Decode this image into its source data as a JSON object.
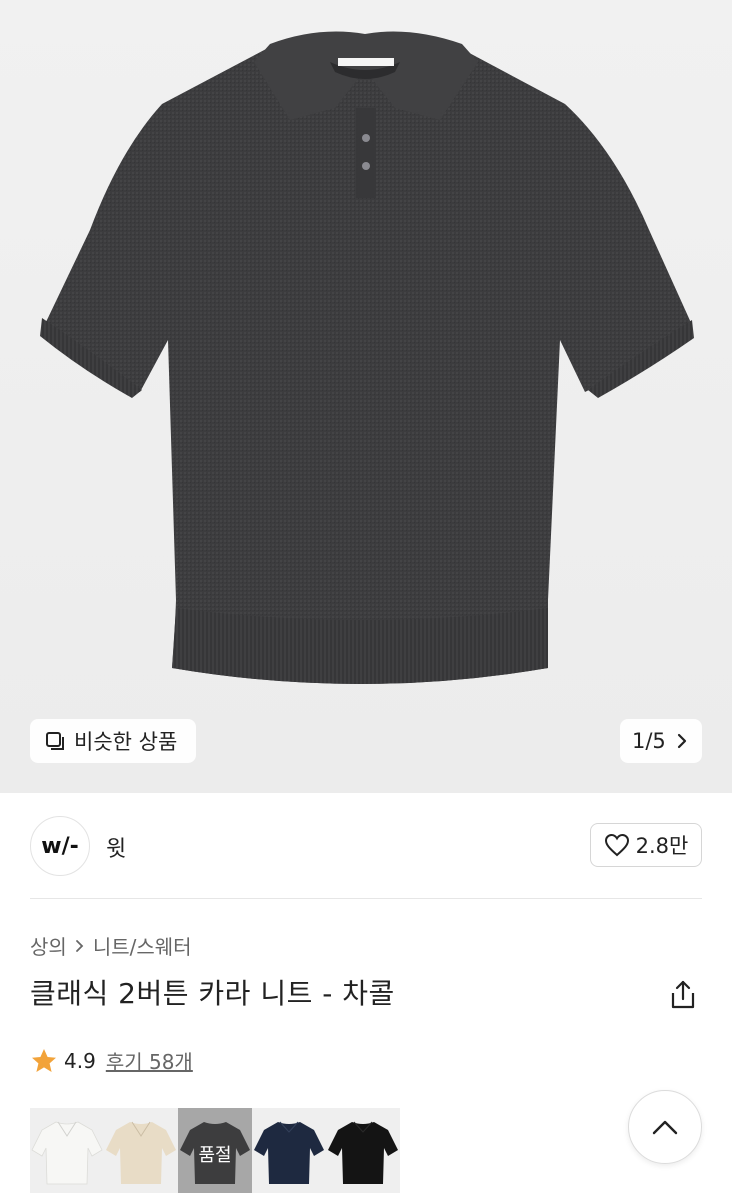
{
  "gallery": {
    "similar_label": "비슷한 상품",
    "counter": "1/5"
  },
  "brand": {
    "logo_text": "w/-",
    "name": "윗"
  },
  "like": {
    "count": "2.8만"
  },
  "breadcrumb": {
    "category": "상의",
    "subcategory": "니트/스웨터"
  },
  "product": {
    "title": "클래식 2버튼 카라 니트 - 차콜"
  },
  "rating": {
    "score": "4.9",
    "reviews": "후기 58개",
    "star_color": "#F2A33A"
  },
  "swatches": [
    {
      "color": "#f4f4f2",
      "sold_out": false
    },
    {
      "color": "#e6d9c3",
      "sold_out": false
    },
    {
      "color": "#2f2f2f",
      "sold_out": true,
      "label": "품절"
    },
    {
      "color": "#1f2a3f",
      "sold_out": false
    },
    {
      "color": "#151515",
      "sold_out": false
    }
  ],
  "colors": {
    "shirt": "#3d3d3f",
    "background": "#efefef"
  }
}
